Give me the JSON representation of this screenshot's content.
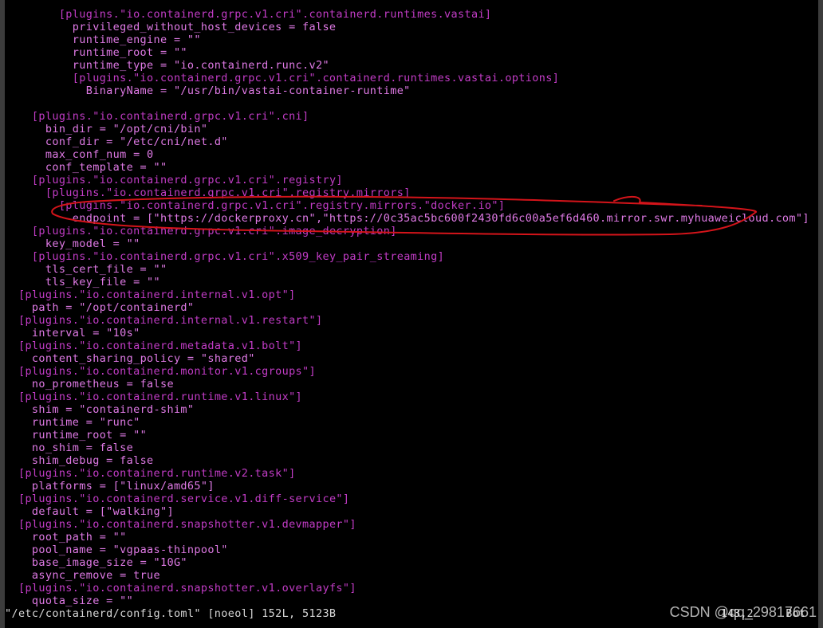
{
  "editor": {
    "lines": [
      {
        "indent": "        ",
        "text": "[plugins.\"io.containerd.grpc.v1.cri\".containerd.runtimes.vastai]",
        "kind": "sec"
      },
      {
        "indent": "          ",
        "text": "privileged_without_host_devices = false",
        "kind": "kv"
      },
      {
        "indent": "          ",
        "text": "runtime_engine = \"\"",
        "kind": "kv"
      },
      {
        "indent": "          ",
        "text": "runtime_root = \"\"",
        "kind": "kv"
      },
      {
        "indent": "          ",
        "text": "runtime_type = \"io.containerd.runc.v2\"",
        "kind": "kv"
      },
      {
        "indent": "          ",
        "text": "[plugins.\"io.containerd.grpc.v1.cri\".containerd.runtimes.vastai.options]",
        "kind": "sec"
      },
      {
        "indent": "            ",
        "text": "BinaryName = \"/usr/bin/vastai-container-runtime\"",
        "kind": "kv"
      },
      {
        "indent": "",
        "text": "",
        "kind": "kv"
      },
      {
        "indent": "    ",
        "text": "[plugins.\"io.containerd.grpc.v1.cri\".cni]",
        "kind": "sec"
      },
      {
        "indent": "      ",
        "text": "bin_dir = \"/opt/cni/bin\"",
        "kind": "kv"
      },
      {
        "indent": "      ",
        "text": "conf_dir = \"/etc/cni/net.d\"",
        "kind": "kv"
      },
      {
        "indent": "      ",
        "text": "max_conf_num = 0",
        "kind": "kv"
      },
      {
        "indent": "      ",
        "text": "conf_template = \"\"",
        "kind": "kv"
      },
      {
        "indent": "    ",
        "text": "[plugins.\"io.containerd.grpc.v1.cri\".registry]",
        "kind": "sec"
      },
      {
        "indent": "      ",
        "text": "[plugins.\"io.containerd.grpc.v1.cri\".registry.mirrors]",
        "kind": "sec"
      },
      {
        "indent": "        ",
        "text": "[plugins.\"io.containerd.grpc.v1.cri\".registry.mirrors.\"docker.io\"]",
        "kind": "sec"
      },
      {
        "indent": "          ",
        "text": "endpoint = [\"https://dockerproxy.cn\",\"https://0c35ac5bc600f2430fd6c00a5ef6d460.mirror.swr.myhuaweicloud.com\"]",
        "kind": "kv"
      },
      {
        "indent": "    ",
        "text": "[plugins.\"io.containerd.grpc.v1.cri\".image_decryption]",
        "kind": "sec"
      },
      {
        "indent": "      ",
        "text": "key_model = \"\"",
        "kind": "kv"
      },
      {
        "indent": "    ",
        "text": "[plugins.\"io.containerd.grpc.v1.cri\".x509_key_pair_streaming]",
        "kind": "sec"
      },
      {
        "indent": "      ",
        "text": "tls_cert_file = \"\"",
        "kind": "kv"
      },
      {
        "indent": "      ",
        "text": "tls_key_file = \"\"",
        "kind": "kv"
      },
      {
        "indent": "  ",
        "text": "[plugins.\"io.containerd.internal.v1.opt\"]",
        "kind": "sec"
      },
      {
        "indent": "    ",
        "text": "path = \"/opt/containerd\"",
        "kind": "kv"
      },
      {
        "indent": "  ",
        "text": "[plugins.\"io.containerd.internal.v1.restart\"]",
        "kind": "sec"
      },
      {
        "indent": "    ",
        "text": "interval = \"10s\"",
        "kind": "kv"
      },
      {
        "indent": "  ",
        "text": "[plugins.\"io.containerd.metadata.v1.bolt\"]",
        "kind": "sec"
      },
      {
        "indent": "    ",
        "text": "content_sharing_policy = \"shared\"",
        "kind": "kv"
      },
      {
        "indent": "  ",
        "text": "[plugins.\"io.containerd.monitor.v1.cgroups\"]",
        "kind": "sec"
      },
      {
        "indent": "    ",
        "text": "no_prometheus = false",
        "kind": "kv"
      },
      {
        "indent": "  ",
        "text": "[plugins.\"io.containerd.runtime.v1.linux\"]",
        "kind": "sec"
      },
      {
        "indent": "    ",
        "text": "shim = \"containerd-shim\"",
        "kind": "kv"
      },
      {
        "indent": "    ",
        "text": "runtime = \"runc\"",
        "kind": "kv"
      },
      {
        "indent": "    ",
        "text": "runtime_root = \"\"",
        "kind": "kv"
      },
      {
        "indent": "    ",
        "text": "no_shim = false",
        "kind": "kv"
      },
      {
        "indent": "    ",
        "text": "shim_debug = false",
        "kind": "kv"
      },
      {
        "indent": "  ",
        "text": "[plugins.\"io.containerd.runtime.v2.task\"]",
        "kind": "sec"
      },
      {
        "indent": "    ",
        "text": "platforms = [\"linux/amd65\"]",
        "kind": "kv"
      },
      {
        "indent": "  ",
        "text": "[plugins.\"io.containerd.service.v1.diff-service\"]",
        "kind": "sec"
      },
      {
        "indent": "    ",
        "text": "default = [\"walking\"]",
        "kind": "kv"
      },
      {
        "indent": "  ",
        "text": "[plugins.\"io.containerd.snapshotter.v1.devmapper\"]",
        "kind": "sec"
      },
      {
        "indent": "    ",
        "text": "root_path = \"\"",
        "kind": "kv"
      },
      {
        "indent": "    ",
        "text": "pool_name = \"vgpaas-thinpool\"",
        "kind": "kv"
      },
      {
        "indent": "    ",
        "text": "base_image_size = \"10G\"",
        "kind": "kv"
      },
      {
        "indent": "    ",
        "text": "async_remove = true",
        "kind": "kv"
      },
      {
        "indent": "  ",
        "text": "[plugins.\"io.containerd.snapshotter.v1.overlayfs\"]",
        "kind": "sec"
      },
      {
        "indent": "    ",
        "text": "quota_size = \"\"",
        "kind": "kv"
      }
    ],
    "status_line": "\"/etc/containerd/config.toml\" [noeol] 152L, 5123B",
    "cursor_position": "143,2",
    "scroll_position": "Bot"
  },
  "colors": {
    "terminal_bg": "#000000",
    "section_text": "#c23cc6",
    "keyvalue_text": "#e07ae6",
    "status_text": "#d8d8d8",
    "annotation_stroke": "#d4141a"
  },
  "watermark": "CSDN @qq_29817661",
  "annotation": "red-hand-drawn-circle"
}
